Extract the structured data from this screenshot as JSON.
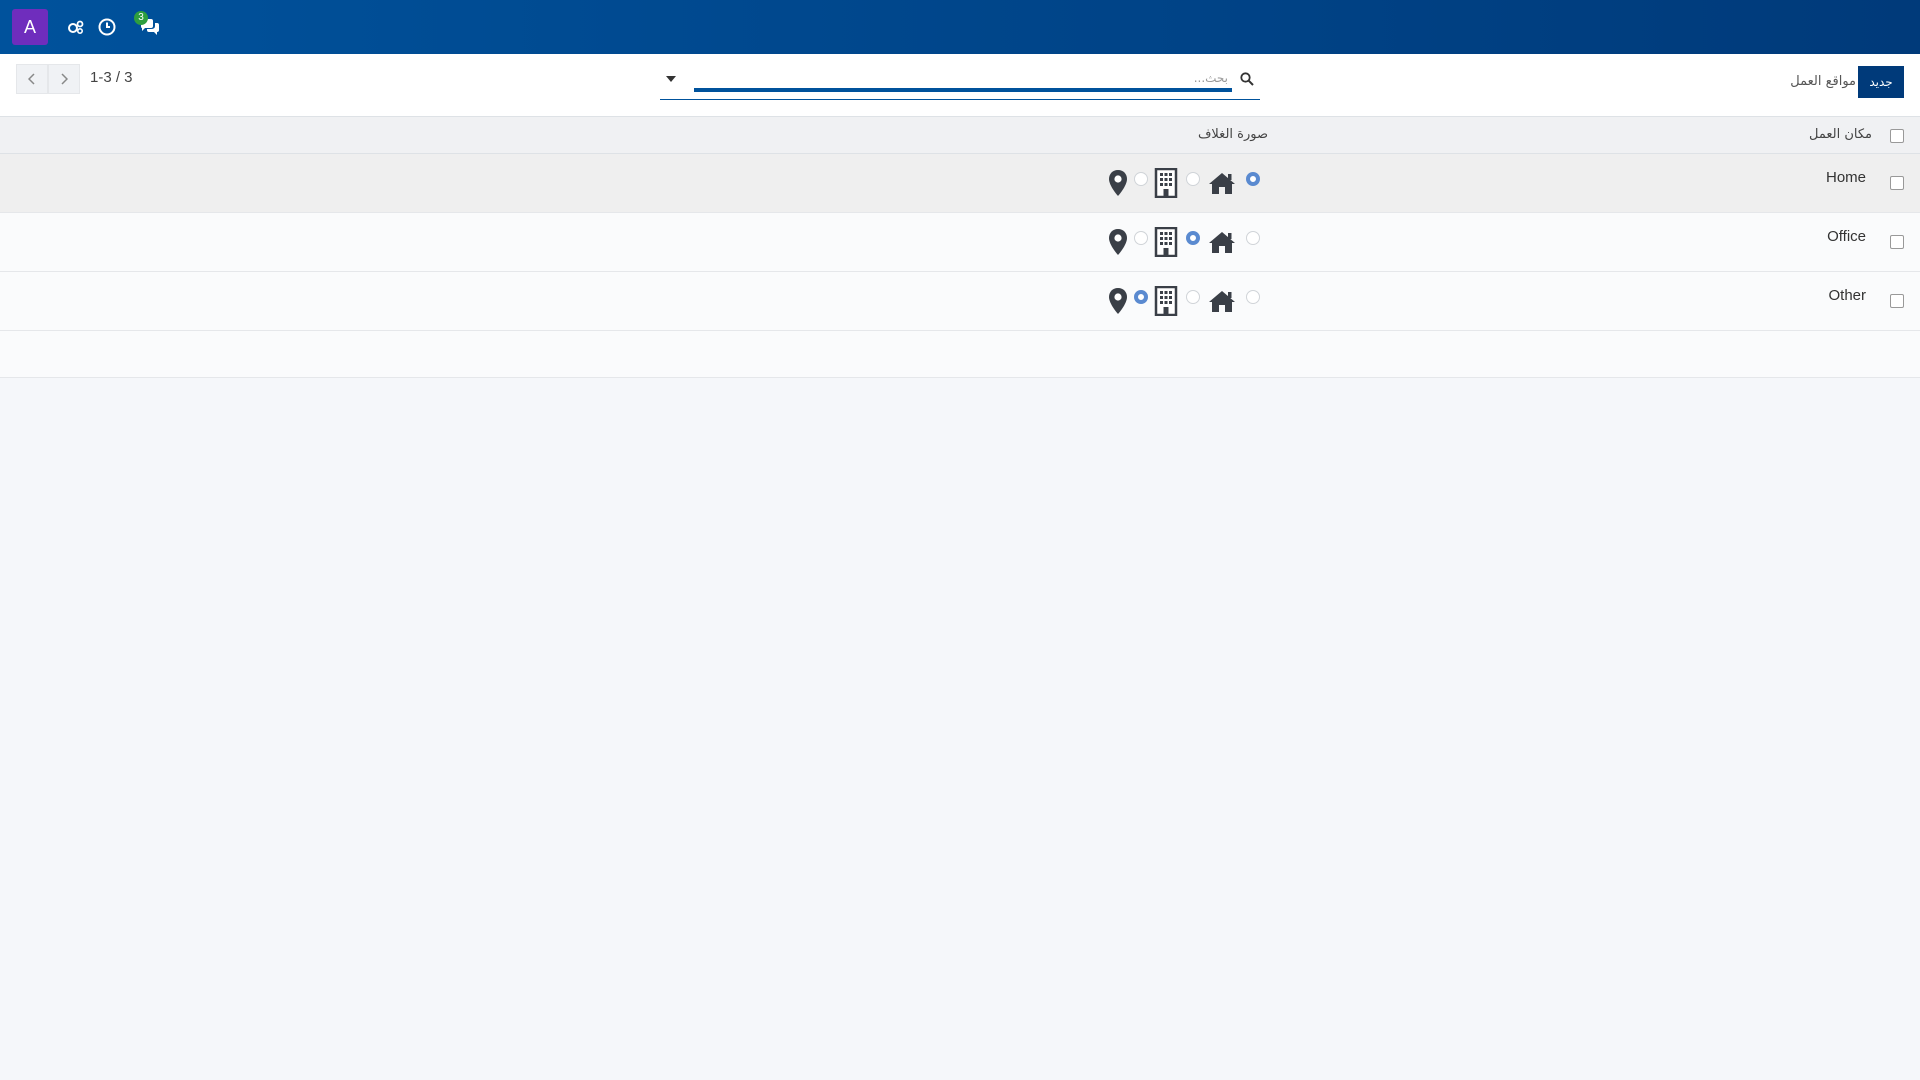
{
  "navbar": {
    "avatar_letter": "A",
    "chat_badge": "3"
  },
  "control_panel": {
    "title": "مواقع العمل",
    "new_label": "جديد",
    "search_placeholder": "بحث...",
    "pager_value": "1-3 / 3"
  },
  "list": {
    "headers": {
      "work_location": "مكان العمل",
      "cover_image": "صورة الغلاف"
    },
    "rows": [
      {
        "name": "Home",
        "selected": "home"
      },
      {
        "name": "Office",
        "selected": "office"
      },
      {
        "name": "Other",
        "selected": "other"
      }
    ]
  },
  "colors": {
    "navbar": "#00529c",
    "avatar": "#6f2dbd",
    "badge": "#2e9e3f",
    "primary_button": "#003a7a",
    "radio_checked": "#5a8ad0",
    "icon": "#3a3f47"
  }
}
